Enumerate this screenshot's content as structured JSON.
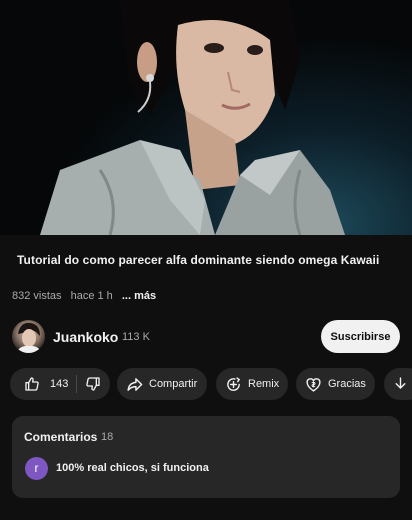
{
  "video": {
    "title": "Tutorial do como parecer alfa dominante  siendo omega Kawaii",
    "views": "832 vistas",
    "time": "hace 1 h",
    "more": "... más"
  },
  "channel": {
    "name": "Juankoko",
    "subscribers": "113 K",
    "subscribe_label": "Suscribirse"
  },
  "actions": {
    "likes": "143",
    "share": "Compartir",
    "remix": "Remix",
    "thanks": "Gracias"
  },
  "comments": {
    "title": "Comentarios",
    "count": "18",
    "top_comment": {
      "avatar_letter": "r",
      "text": "100% real chicos, si funciona"
    }
  },
  "colors": {
    "background": "#0f0f0f",
    "pill": "#272727",
    "subscribe_bg": "#f1f1f1",
    "comment_avatar": "#7e57c2"
  },
  "icons": [
    "thumbs-up-icon",
    "thumbs-down-icon",
    "share-icon",
    "remix-icon",
    "thanks-icon",
    "download-icon"
  ]
}
